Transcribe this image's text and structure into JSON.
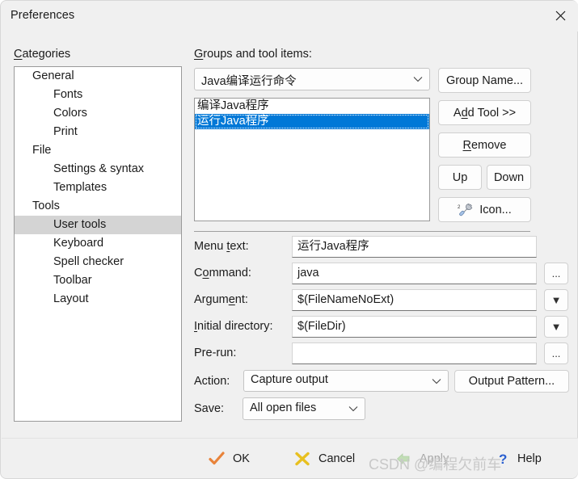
{
  "window": {
    "title": "Preferences",
    "close_icon": "close-icon"
  },
  "categories": {
    "label_pre": "",
    "label_mnemonic": "C",
    "label_post": "ategories",
    "items": [
      {
        "label": "General",
        "level": 1,
        "selected": false
      },
      {
        "label": "Fonts",
        "level": 2,
        "selected": false
      },
      {
        "label": "Colors",
        "level": 2,
        "selected": false
      },
      {
        "label": "Print",
        "level": 2,
        "selected": false
      },
      {
        "label": "File",
        "level": 1,
        "selected": false
      },
      {
        "label": "Settings & syntax",
        "level": 2,
        "selected": false
      },
      {
        "label": "Templates",
        "level": 2,
        "selected": false
      },
      {
        "label": "Tools",
        "level": 1,
        "selected": false
      },
      {
        "label": "User tools",
        "level": 2,
        "selected": true
      },
      {
        "label": "Keyboard",
        "level": 2,
        "selected": false
      },
      {
        "label": "Spell checker",
        "level": 2,
        "selected": false
      },
      {
        "label": "Toolbar",
        "level": 2,
        "selected": false
      },
      {
        "label": "Layout",
        "level": 2,
        "selected": false
      }
    ]
  },
  "groups": {
    "label_mnemonic": "G",
    "label_post": "roups and tool items:",
    "selected_group": "Java编译运行命令",
    "tools": [
      {
        "label": "编译Java程序",
        "selected": false
      },
      {
        "label": "运行Java程序",
        "selected": true
      }
    ]
  },
  "buttons": {
    "group_name": {
      "pre": "Group Name...",
      "mnemonic": "",
      "post": ""
    },
    "add_tool": {
      "pre": "A",
      "mnemonic": "d",
      "post": "d Tool >>"
    },
    "remove": {
      "pre": "",
      "mnemonic": "R",
      "post": "emove"
    },
    "up": {
      "pre": "Up",
      "mnemonic": "",
      "post": ""
    },
    "down": {
      "pre": "Down",
      "mnemonic": "",
      "post": ""
    },
    "icon": {
      "pre": "Icon...",
      "mnemonic": "",
      "post": "",
      "glyph": "wrench-screwdriver-icon"
    },
    "output_pattern": {
      "pre": "Output Pattern...",
      "mnemonic": "",
      "post": ""
    }
  },
  "form": {
    "menu_text": {
      "pre": "Menu ",
      "mnemonic": "t",
      "post": "ext:",
      "value": "运行Java程序",
      "placeholder": ""
    },
    "command": {
      "pre": "C",
      "mnemonic": "o",
      "post": "mmand:",
      "value": "java",
      "placeholder": "",
      "side_button": "..."
    },
    "argument": {
      "pre": "Argum",
      "mnemonic": "e",
      "post": "nt:",
      "value": "$(FileNameNoExt)",
      "placeholder": "",
      "side_button": "▼"
    },
    "initial_dir": {
      "pre": "",
      "mnemonic": "I",
      "post": "nitial directory:",
      "value": "$(FileDir)",
      "placeholder": "",
      "side_button": "▼"
    },
    "pre_run": {
      "pre": "Pre-run:",
      "mnemonic": "",
      "post": "",
      "value": "",
      "placeholder": "",
      "side_button": "..."
    },
    "action": {
      "label": "Action:",
      "value": "Capture output"
    },
    "save": {
      "label": "Save:",
      "value": "All open files"
    }
  },
  "footer": {
    "ok": {
      "label": "OK",
      "icon": "check-icon",
      "enabled": true
    },
    "cancel": {
      "label": "Cancel",
      "icon": "cross-icon",
      "enabled": true
    },
    "apply": {
      "label": "Apply",
      "icon": "left-arrow-icon",
      "enabled": false
    },
    "help": {
      "label": "Help",
      "icon": "question-icon",
      "enabled": true
    }
  },
  "watermark": {
    "text": "CSDN @编程欠前车"
  },
  "colors": {
    "accent_selection": "#0078d7",
    "tree_selection": "#d4d4d4",
    "dialog_bg": "#f0f0f0",
    "ok_icon": "#e8833a",
    "cancel_icon": "#e8c020",
    "apply_icon": "#b5d9a8",
    "help_icon": "#2a5fd0"
  }
}
